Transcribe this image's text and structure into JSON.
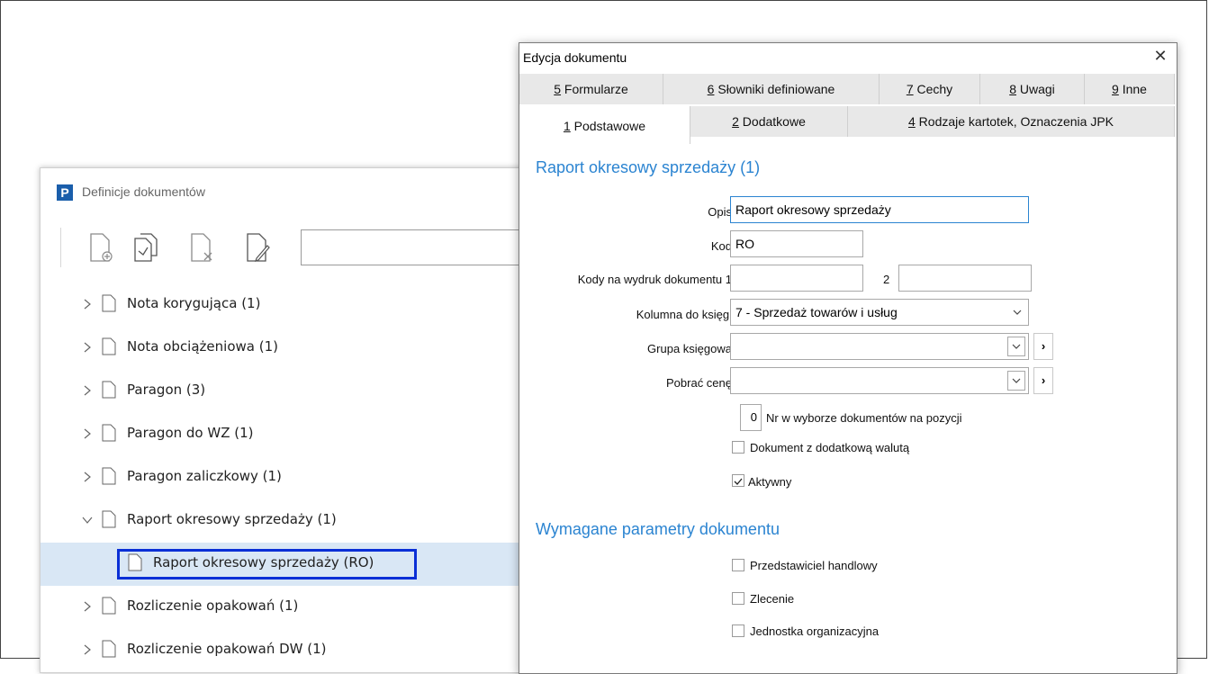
{
  "definitions_window": {
    "logo": "P",
    "title": "Definicje dokumentów",
    "toolbar": {
      "buttons": [
        "add-document-icon",
        "copy-document-icon",
        "delete-document-icon",
        "edit-document-icon"
      ],
      "search_value": ""
    },
    "tree": [
      {
        "label": "Nota korygująca (1)",
        "expanded": false
      },
      {
        "label": "Nota obciążeniowa (1)",
        "expanded": false
      },
      {
        "label": "Paragon (3)",
        "expanded": false
      },
      {
        "label": "Paragon do WZ (1)",
        "expanded": false
      },
      {
        "label": "Paragon zaliczkowy (1)",
        "expanded": false
      },
      {
        "label": "Raport okresowy sprzedaży (1)",
        "expanded": true
      },
      {
        "label": "Raport okresowy sprzedaży (RO)",
        "child": true,
        "selected": true
      },
      {
        "label": "Rozliczenie opakowań (1)",
        "expanded": false
      },
      {
        "label": "Rozliczenie opakowań DW (1)",
        "expanded": false
      }
    ]
  },
  "dialog": {
    "title": "Edycja dokumentu",
    "close": "✕",
    "tabs_row1": [
      {
        "key": "5",
        "rest": " Formularze"
      },
      {
        "key": "6",
        "rest": " Słowniki definiowane"
      },
      {
        "key": "7",
        "rest": " Cechy"
      },
      {
        "key": "8",
        "rest": " Uwagi"
      },
      {
        "key": "9",
        "rest": " Inne"
      }
    ],
    "tabs_row2": [
      {
        "key": "1",
        "rest": " Podstawowe",
        "active": true
      },
      {
        "key": "2",
        "rest": " Dodatkowe"
      },
      {
        "key": "4",
        "rest": " Rodzaje kartotek, Oznaczenia JPK"
      }
    ],
    "section1_title": "Raport okresowy sprzedaży (1)",
    "fields": {
      "opis_label": "Opis",
      "opis_value": "Raport okresowy sprzedaży",
      "kod_label": "Kod",
      "kod_value": "RO",
      "kody_label": "Kody na wydruk dokumentu 1",
      "kody_value1": "",
      "kody_label2": "2",
      "kody_value2": "",
      "kolumna_label": "Kolumna do księgi",
      "kolumna_value": "7 - Sprzedaż towarów i usług",
      "grupa_label": "Grupa księgowa",
      "grupa_value": "",
      "cena_label": "Pobrać cenę",
      "cena_value": "",
      "nr_value": "0",
      "nr_label": "Nr w wyborze dokumentów na pozycji",
      "waluta_label": "Dokument z dodatkową walutą",
      "waluta_checked": false,
      "aktywny_label": "Aktywny",
      "aktywny_checked": true,
      "go_symbol": "›"
    },
    "section2_title": "Wymagane parametry dokumentu",
    "params": [
      {
        "label": "Przedstawiciel handlowy",
        "checked": false
      },
      {
        "label": "Zlecenie",
        "checked": false
      },
      {
        "label": "Jednostka organizacyjna",
        "checked": false
      }
    ]
  },
  "colors": {
    "accent": "#2b84d1",
    "selection_bg": "#d9e7f5",
    "selection_border": "#0a2fd6",
    "tab_bg": "#e8e8e8",
    "logo_bg": "#1a5eab"
  }
}
